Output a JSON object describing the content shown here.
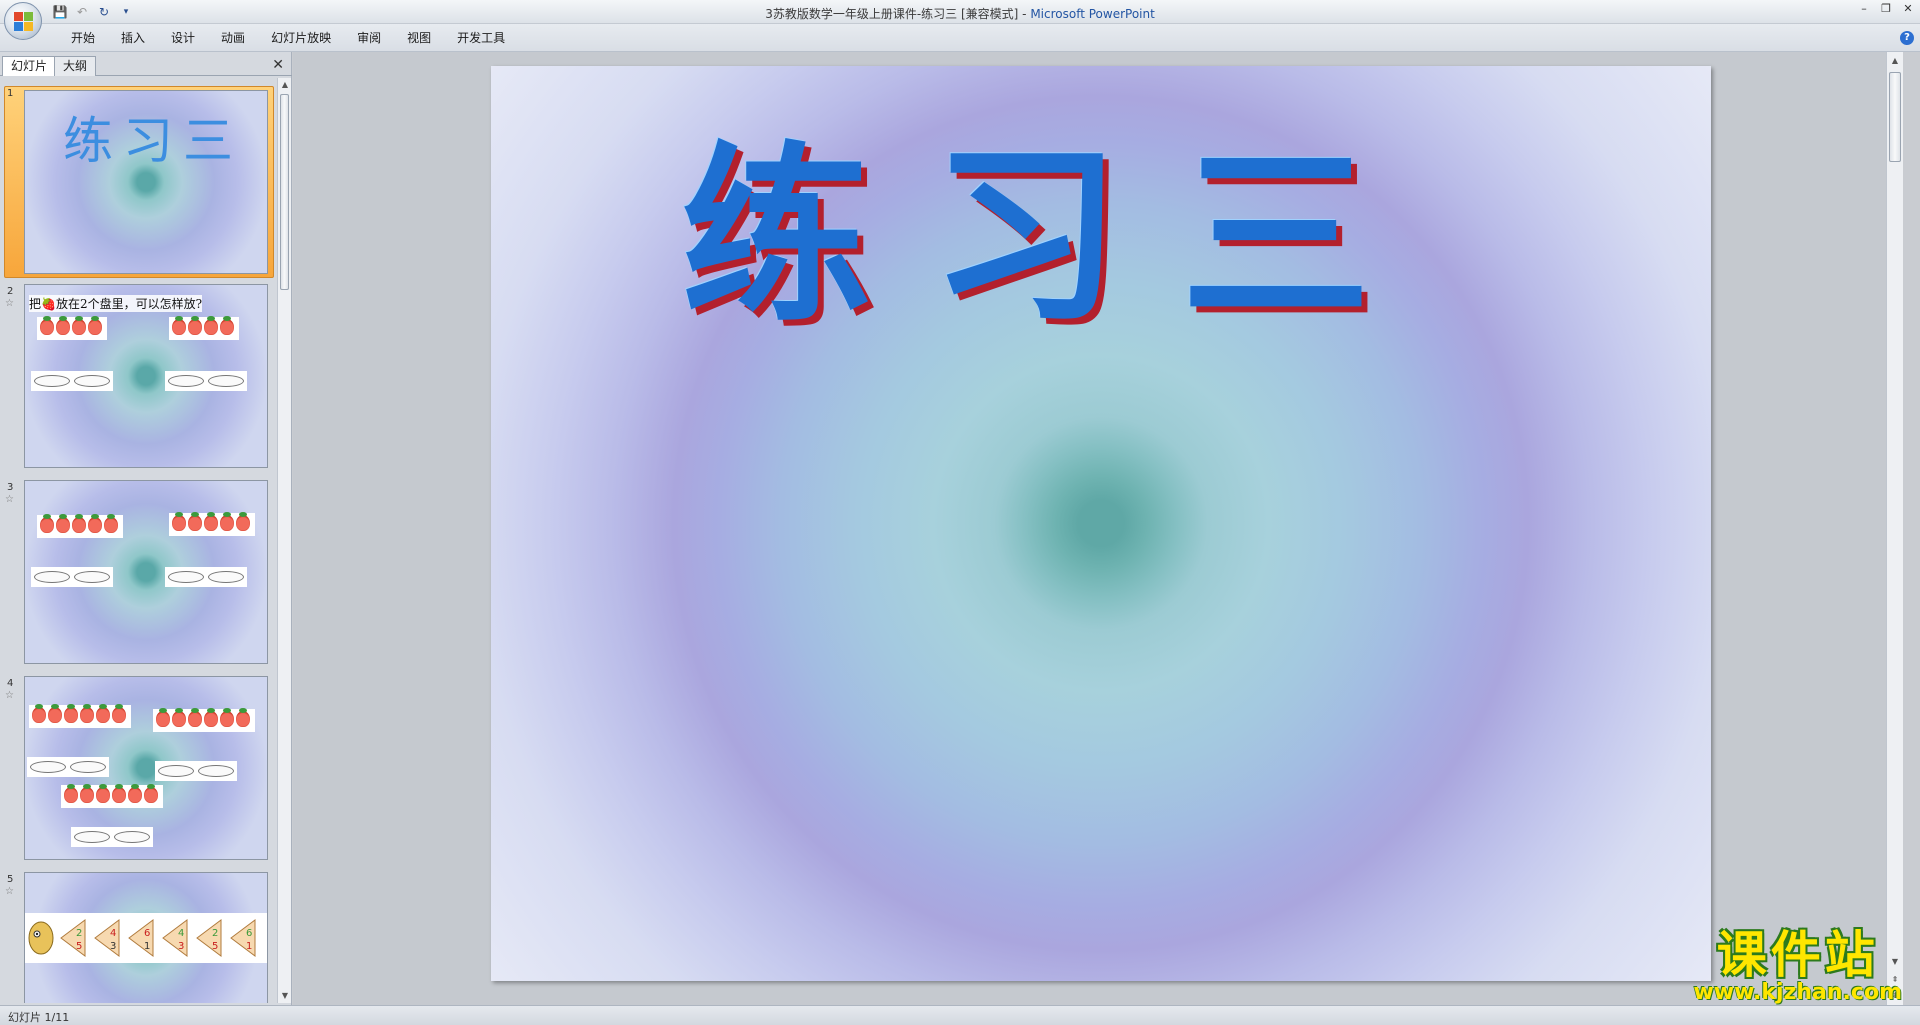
{
  "window": {
    "title": "3苏教版数学一年级上册课件-练习三 [兼容模式]",
    "app_name": "Microsoft PowerPoint",
    "title_separator": " - "
  },
  "ribbon": {
    "tabs": [
      {
        "label": "开始"
      },
      {
        "label": "插入"
      },
      {
        "label": "设计"
      },
      {
        "label": "动画"
      },
      {
        "label": "幻灯片放映"
      },
      {
        "label": "审阅"
      },
      {
        "label": "视图"
      },
      {
        "label": "开发工具"
      }
    ]
  },
  "left_pane": {
    "tabs": [
      {
        "label": "幻灯片"
      },
      {
        "label": "大纲"
      }
    ],
    "close_glyph": "✕"
  },
  "slides": [
    {
      "number": "1",
      "title": "练习三"
    },
    {
      "number": "2",
      "prompt": "把🍓放在2个盘里，可以怎样放?"
    },
    {
      "number": "3"
    },
    {
      "number": "4"
    },
    {
      "number": "5",
      "fractions": [
        {
          "top": "2",
          "bottom": "5"
        },
        {
          "top": "4",
          "bottom": "3"
        },
        {
          "top": "6",
          "bottom": "1"
        },
        {
          "top": "4",
          "bottom": "3"
        },
        {
          "top": "2",
          "bottom": "5"
        },
        {
          "top": "6",
          "bottom": "1"
        }
      ]
    }
  ],
  "current_slide": {
    "title": "练习三"
  },
  "status_bar": {
    "slide_indicator": "幻灯片 1/11"
  },
  "watermark": {
    "name": "课件站",
    "url": "www.kjzhan.com"
  },
  "colors": {
    "accent": "#1e6fd1",
    "title_shadow": "#b3202d",
    "selection": "#f7a63b"
  }
}
